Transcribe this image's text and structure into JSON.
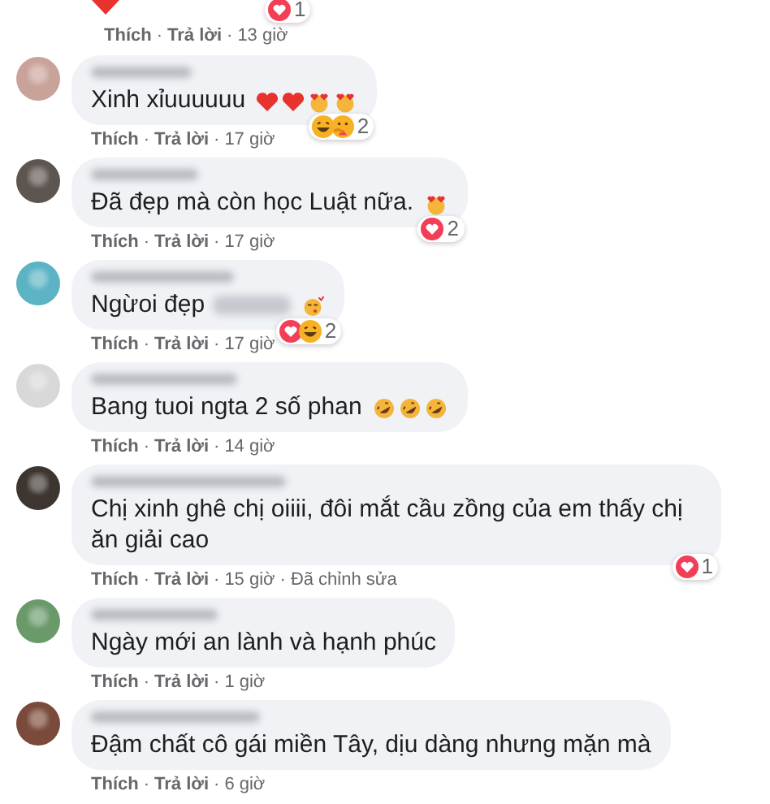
{
  "separator": "·",
  "previous_comment": {
    "emojis": [
      {
        "kind": "heart"
      }
    ],
    "reactions": {
      "types": [
        {
          "kind": "love"
        }
      ],
      "count": "1"
    },
    "meta": [
      {
        "text": "Thích",
        "kind": "action"
      },
      {
        "text": "Trả lời",
        "kind": "action"
      },
      {
        "text": "13 giờ",
        "kind": "time"
      }
    ]
  },
  "comments": [
    {
      "text": "Xinh xỉuuuuuu",
      "mention_blurred": false,
      "emojis": [
        {
          "kind": "heart"
        },
        {
          "kind": "heart"
        },
        {
          "kind": "heart-eyes"
        },
        {
          "kind": "heart-eyes"
        }
      ],
      "reactions": {
        "types": [
          {
            "kind": "haha"
          },
          {
            "kind": "care"
          }
        ],
        "count": "2"
      },
      "meta": [
        {
          "text": "Thích",
          "kind": "action"
        },
        {
          "text": "Trả lời",
          "kind": "action"
        },
        {
          "text": "17 giờ",
          "kind": "time"
        }
      ]
    },
    {
      "text": "Đã đẹp mà còn học Luật nữa.",
      "mention_blurred": false,
      "emojis": [
        {
          "kind": "heart-eyes"
        }
      ],
      "reactions": {
        "types": [
          {
            "kind": "love"
          }
        ],
        "count": "2"
      },
      "meta": [
        {
          "text": "Thích",
          "kind": "action"
        },
        {
          "text": "Trả lời",
          "kind": "action"
        },
        {
          "text": "17 giờ",
          "kind": "time"
        }
      ]
    },
    {
      "text": "Ngừoi đẹp",
      "mention_blurred": true,
      "emojis": [
        {
          "kind": "kiss"
        }
      ],
      "reactions": {
        "types": [
          {
            "kind": "love"
          },
          {
            "kind": "haha"
          }
        ],
        "count": "2"
      },
      "meta": [
        {
          "text": "Thích",
          "kind": "action"
        },
        {
          "text": "Trả lời",
          "kind": "action"
        },
        {
          "text": "17 giờ",
          "kind": "time"
        }
      ]
    },
    {
      "text": "Bang tuoi ngta 2 số phan",
      "mention_blurred": false,
      "emojis": [
        {
          "kind": "rofl"
        },
        {
          "kind": "rofl"
        },
        {
          "kind": "rofl"
        }
      ],
      "meta": [
        {
          "text": "Thích",
          "kind": "action"
        },
        {
          "text": "Trả lời",
          "kind": "action"
        },
        {
          "text": "14 giờ",
          "kind": "time"
        }
      ]
    },
    {
      "text": "Chị xinh ghê chị oiiii, đôi mắt cầu zồng của em thấy chị ăn giải cao",
      "mention_blurred": false,
      "reactions": {
        "types": [
          {
            "kind": "love"
          }
        ],
        "count": "1"
      },
      "meta": [
        {
          "text": "Thích",
          "kind": "action"
        },
        {
          "text": "Trả lời",
          "kind": "action"
        },
        {
          "text": "15 giờ",
          "kind": "time"
        },
        {
          "text": "Đã chỉnh sửa",
          "kind": "time"
        }
      ]
    },
    {
      "text": "Ngày mới an lành và hạnh phúc",
      "mention_blurred": false,
      "meta": [
        {
          "text": "Thích",
          "kind": "action"
        },
        {
          "text": "Trả lời",
          "kind": "action"
        },
        {
          "text": "1 giờ",
          "kind": "time"
        }
      ]
    },
    {
      "text": "Đậm chất cô gái miền Tây, dịu dàng nhưng mặn mà",
      "mention_blurred": false,
      "meta": [
        {
          "text": "Thích",
          "kind": "action"
        },
        {
          "text": "Trả lời",
          "kind": "action"
        },
        {
          "text": "6 giờ",
          "kind": "time"
        }
      ]
    }
  ]
}
